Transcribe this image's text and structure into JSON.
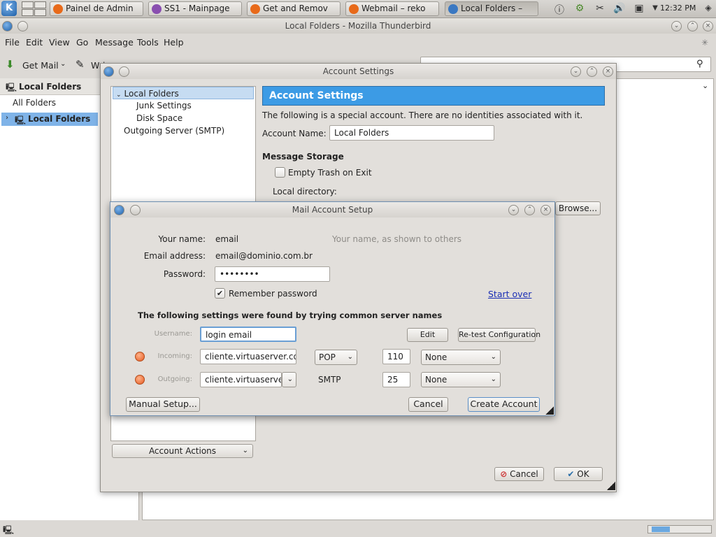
{
  "taskbar": {
    "tasks": [
      {
        "label": "Painel de Admin",
        "color": "#e86a1a"
      },
      {
        "label": "SS1 - Mainpage",
        "color": "#8a4fb0"
      },
      {
        "label": "Get and Remov",
        "color": "#e86a1a"
      },
      {
        "label": "Webmail – reko",
        "color": "#e86a1a"
      },
      {
        "label": "Local Folders –",
        "color": "#3a78c2"
      }
    ],
    "clock": "12:32 PM"
  },
  "thunderbird": {
    "title": "Local Folders - Mozilla Thunderbird",
    "menu": [
      "File",
      "Edit",
      "View",
      "Go",
      "Message",
      "Tools",
      "Help"
    ],
    "toolbar": {
      "get_mail": "Get Mail",
      "write": "Wri"
    },
    "folder_header": "Local Folders",
    "all_folders": "All Folders",
    "folder_item": "Local Folders"
  },
  "account_settings": {
    "title": "Account Settings",
    "tree": {
      "local_folders": "Local Folders",
      "junk": "Junk Settings",
      "disk": "Disk Space",
      "smtp": "Outgoing Server (SMTP)"
    },
    "account_actions": "Account Actions",
    "header": "Account Settings",
    "special_note": "The following is a special account. There are no identities associated with it.",
    "account_name_label": "Account Name:",
    "account_name_value": "Local Folders",
    "message_storage": "Message Storage",
    "empty_trash": "Empty Trash on Exit",
    "local_directory": "Local directory:",
    "browse": "Browse...",
    "cancel": "Cancel",
    "ok": "OK"
  },
  "mail_setup": {
    "title": "Mail Account Setup",
    "your_name_label": "Your name:",
    "your_name_value": "email",
    "your_name_hint": "Your name, as shown to others",
    "email_label": "Email address:",
    "email_value": "email@dominio.com.br",
    "password_label": "Password:",
    "password_value": "••••••••",
    "remember_password": "Remember password",
    "start_over": "Start over",
    "found_settings": "The following settings were found by trying common server names",
    "username_label": "Username:",
    "username_value": "login email",
    "edit": "Edit",
    "retest": "Re-test Configuration",
    "incoming_label": "Incoming:",
    "incoming_server": "cliente.virtuaserver.com",
    "incoming_protocol": "POP",
    "incoming_port": "110",
    "incoming_security": "None",
    "outgoing_label": "Outgoing:",
    "outgoing_server": "cliente.virtuaserver",
    "outgoing_protocol": "SMTP",
    "outgoing_port": "25",
    "outgoing_security": "None",
    "manual_setup": "Manual Setup...",
    "cancel": "Cancel",
    "create_account": "Create Account"
  }
}
